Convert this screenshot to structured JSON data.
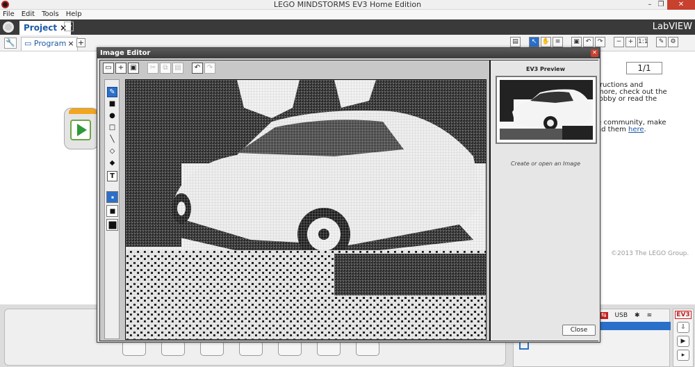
{
  "window": {
    "title": "LEGO MINDSTORMS EV3 Home Edition",
    "minimize": "–",
    "maximize": "❐",
    "close": "✕"
  },
  "menu": [
    "File",
    "Edit",
    "Tools",
    "Help"
  ],
  "project": {
    "tab_label": "Project",
    "close": "×",
    "add": "+",
    "brand": "LabVIEW"
  },
  "program": {
    "tab_label": "Program",
    "close": "×",
    "add": "+"
  },
  "toolbar": {
    "page": "1/1",
    "zoom_reset": "1:1"
  },
  "lobby_panel": {
    "lines_1": [
      "tructions and",
      "more, check out the",
      "lobby or read the"
    ],
    "lines_2": [
      "e community, make",
      "ad them "
    ],
    "link": "here",
    "link_end": ".",
    "copyright": "©2013 The LEGO Group."
  },
  "hardware": {
    "usb": "USB",
    "bluetooth": "✱",
    "wifi": "≋",
    "ev3": "EV3"
  },
  "image_editor": {
    "title": "Image Editor",
    "preview_title": "EV3 Preview",
    "hint": "Create or open an Image",
    "close_button": "Close",
    "tools": [
      "pencil",
      "filled-rectangle",
      "filled-ellipse",
      "rectangle",
      "line",
      "fill",
      "eraser",
      "text"
    ],
    "text_tool_glyph": "T",
    "pen_sizes": [
      "small",
      "medium",
      "large"
    ],
    "active_tool": "pencil",
    "active_pen_size": "small"
  }
}
